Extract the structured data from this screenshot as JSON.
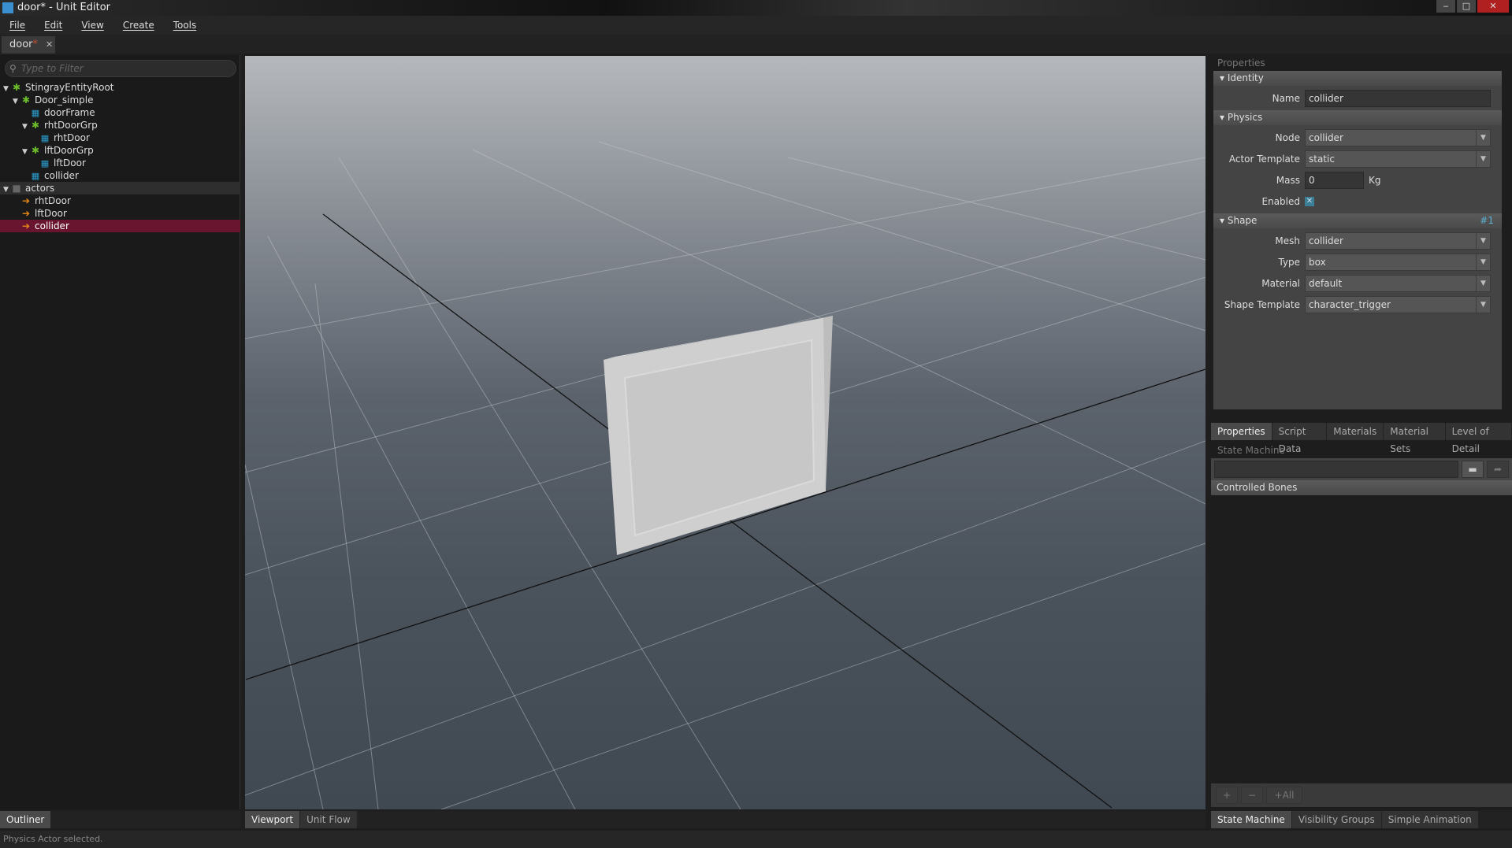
{
  "window": {
    "title": "door* - Unit Editor",
    "buttons": [
      "minimize",
      "maximize",
      "close"
    ]
  },
  "menu": [
    "File",
    "Edit",
    "View",
    "Create",
    "Tools"
  ],
  "doc_tab": {
    "name": "door",
    "modified": "*",
    "close": "✕"
  },
  "outliner": {
    "filter_placeholder": "Type to Filter",
    "items": [
      {
        "label": "StingrayEntityRoot",
        "icon": "entity-icon",
        "depth": 0,
        "expanded": true
      },
      {
        "label": "Door_simple",
        "icon": "entity-icon",
        "depth": 1,
        "expanded": true
      },
      {
        "label": "doorFrame",
        "icon": "mesh-icon",
        "depth": 2
      },
      {
        "label": "rhtDoorGrp",
        "icon": "entity-icon",
        "depth": 2,
        "expanded": true
      },
      {
        "label": "rhtDoor",
        "icon": "mesh-icon",
        "depth": 3
      },
      {
        "label": "lftDoorGrp",
        "icon": "entity-icon",
        "depth": 2,
        "expanded": true
      },
      {
        "label": "lftDoor",
        "icon": "mesh-icon",
        "depth": 3
      },
      {
        "label": "collider",
        "icon": "mesh-icon",
        "depth": 2
      },
      {
        "label": "actors",
        "icon": "folder-icon",
        "depth": 0,
        "expanded": true,
        "group": true
      },
      {
        "label": "rhtDoor",
        "icon": "actor-icon",
        "depth": 1
      },
      {
        "label": "lftDoor",
        "icon": "actor-icon",
        "depth": 1
      },
      {
        "label": "collider",
        "icon": "actor-icon",
        "depth": 1,
        "selected": true
      }
    ],
    "tab": "Outliner"
  },
  "viewport_tabs": [
    "Viewport",
    "Unit Flow"
  ],
  "properties": {
    "header": "Properties",
    "identity": {
      "title": "Identity",
      "name_label": "Name",
      "name_value": "collider"
    },
    "physics": {
      "title": "Physics",
      "node_label": "Node",
      "node_value": "collider",
      "actor_template_label": "Actor Template",
      "actor_template_value": "static",
      "mass_label": "Mass",
      "mass_value": "0",
      "mass_unit": "Kg",
      "enabled_label": "Enabled",
      "enabled": true
    },
    "shape": {
      "title": "Shape",
      "index": "#1",
      "mesh_label": "Mesh",
      "mesh_value": "collider",
      "type_label": "Type",
      "type_value": "box",
      "material_label": "Material",
      "material_value": "default",
      "template_label": "Shape Template",
      "template_value": "character_trigger"
    },
    "tabs": [
      "Properties",
      "Script Data",
      "Materials",
      "Material Sets",
      "Level of Detail"
    ]
  },
  "state_machine": {
    "header": "State Machine",
    "path_value": "",
    "controlled_bones": "Controlled Bones",
    "buttons": [
      "+",
      "−",
      "+All"
    ],
    "tabs": [
      "State Machine",
      "Visibility Groups",
      "Simple Animation"
    ]
  },
  "status": "Physics Actor selected.",
  "colors": {
    "selection": "#6a1530",
    "accent": "#5ab0d0",
    "entity": "#6cbb2a",
    "mesh": "#2a9fd0",
    "actor": "#e88a1a"
  }
}
